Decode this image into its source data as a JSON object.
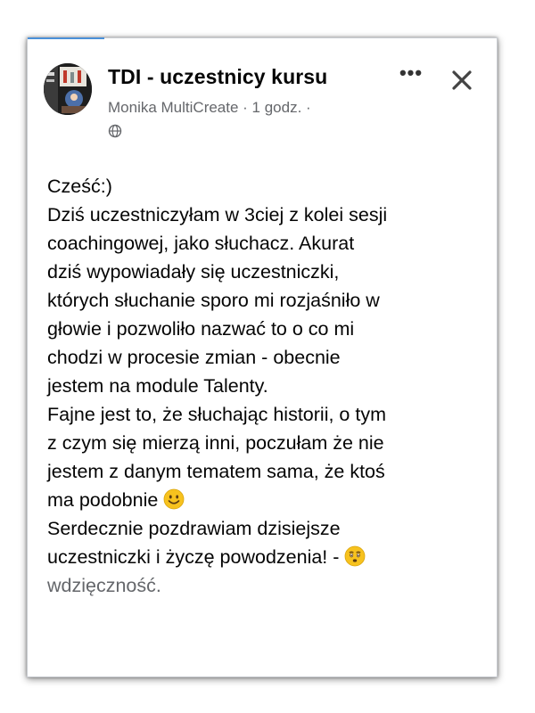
{
  "post": {
    "group_title": "TDI - uczestnicy kursu",
    "meta": "Monika MultiCreate · 1 godz. ·",
    "more_label": "•••",
    "lines": [
      "Cześć:)",
      "Dziś uczestniczyłam w 3ciej z kolei sesji",
      "coachingowej, jako słuchacz. Akurat",
      "dziś wypowiadały się uczestniczki,",
      "których słuchanie sporo mi rozjaśniło w",
      "głowie i pozwoliło nazwać to o co mi",
      "chodzi w procesie zmian - obecnie",
      "jestem na module Talenty.",
      "Fajne jest to, że słuchając historii, o tym",
      "z czym się mierzą inni, poczułam że nie",
      "jestem z danym tematem sama, że ktoś",
      "ma podobnie",
      "Serdecznie pozdrawiam dzisiejsze",
      "uczestniczki i życzę powodzenia! -"
    ],
    "trailing_word": "wdzięczność."
  },
  "icons": {
    "more": "more-horizontal-icon",
    "close": "close-icon",
    "privacy": "globe-icon",
    "emoji_smile": "smiling-face-emoji",
    "emoji_grateful": "grateful-face-emoji"
  },
  "colors": {
    "text": "#050505",
    "muted": "#65676b",
    "emoji_yellow": "#f7c21e"
  }
}
